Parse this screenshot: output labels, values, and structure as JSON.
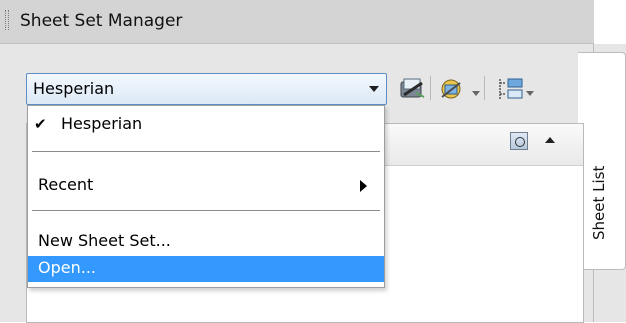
{
  "window": {
    "title": "Sheet Set Manager"
  },
  "combo": {
    "value": "Hesperian"
  },
  "toolbar": {
    "icons": [
      "sheet-set-icon",
      "publish-icon",
      "sheet-properties-icon"
    ]
  },
  "menu": {
    "items": [
      {
        "label": "Hesperian",
        "checked": true
      },
      {
        "label": "Recent",
        "has_submenu": true
      },
      {
        "label": "New Sheet Set..."
      },
      {
        "label": "Open...",
        "highlighted": true
      }
    ]
  },
  "side_tab": {
    "label": "Sheet List"
  },
  "colors": {
    "highlight": "#3399ff",
    "combo_border": "#5e8fc4"
  }
}
